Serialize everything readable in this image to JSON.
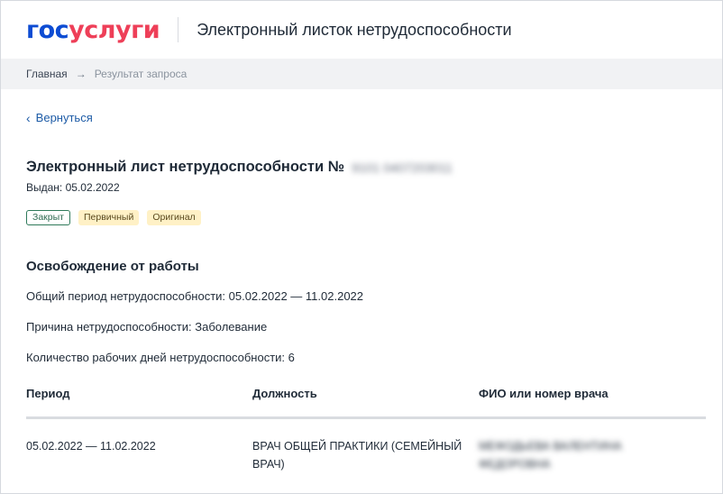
{
  "brand": {
    "logo_part1": "гос",
    "logo_part2": "услуги",
    "colors": {
      "blue": "#0d4cd3",
      "red": "#ee3f58"
    }
  },
  "header": {
    "title": "Электронный листок нетрудоспособности"
  },
  "breadcrumb": {
    "home": "Главная",
    "current": "Результат запроса"
  },
  "back_link": "Вернуться",
  "document": {
    "title": "Электронный лист нетрудоспособности №",
    "number_redacted": "9101 0407203011",
    "issued": "Выдан: 05.02.2022",
    "badges": [
      {
        "label": "Закрыт",
        "style": "outline-green"
      },
      {
        "label": "Первичный",
        "style": "yellow"
      },
      {
        "label": "Оригинал",
        "style": "yellow"
      }
    ]
  },
  "release": {
    "section_title": "Освобождение от работы",
    "period_line": "Общий период нетрудоспособности: 05.02.2022 — 11.02.2022",
    "reason_line": "Причина нетрудоспособности: Заболевание",
    "workdays_line": "Количество рабочих дней нетрудоспособности: 6"
  },
  "table": {
    "columns": [
      "Период",
      "Должность",
      "ФИО или номер врача"
    ],
    "rows": [
      {
        "period": "05.02.2022 — 11.02.2022",
        "position": "ВРАЧ ОБЩЕЙ ПРАКТИКИ (СЕМЕЙНЫЙ ВРАЧ)",
        "doctor_redacted": "МЕФОДЬЕВА ВАЛЕНТИНА ФЕДОРОВНА"
      }
    ]
  }
}
